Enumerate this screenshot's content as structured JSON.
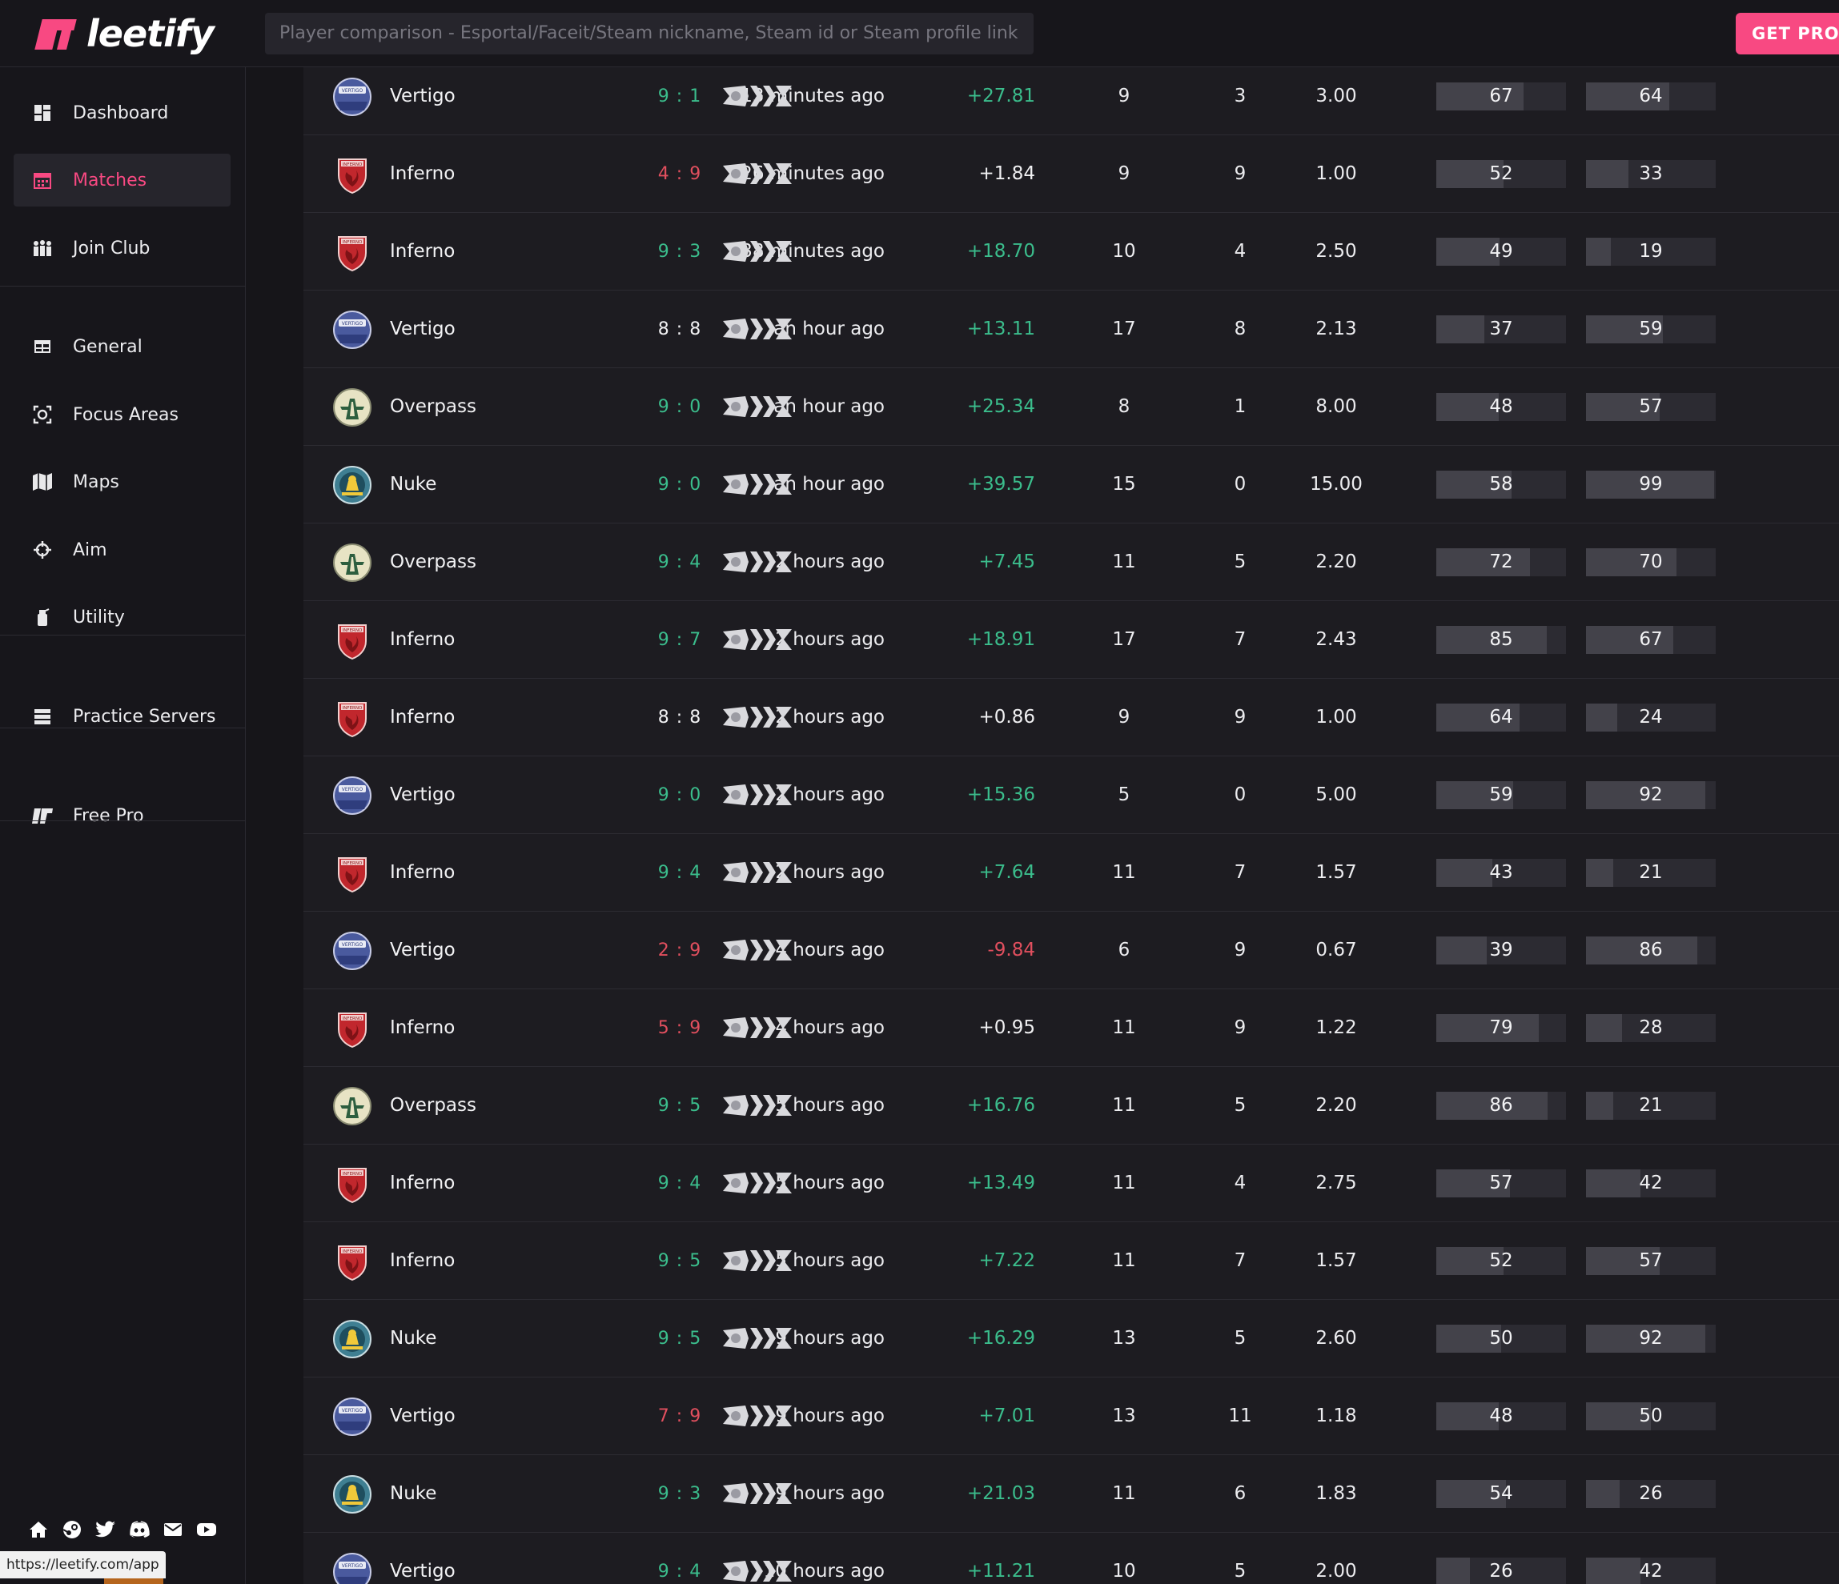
{
  "app": {
    "logo_text": "leetify",
    "get_pro_label": "GET PRO"
  },
  "search": {
    "placeholder": "Player comparison - Esportal/Faceit/Steam nickname, Steam id or Steam profile link"
  },
  "sidebar": {
    "items": [
      {
        "label": "Dashboard",
        "icon": "dashboard-icon",
        "active": false
      },
      {
        "label": "Matches",
        "icon": "calendar-icon",
        "active": true
      },
      {
        "label": "Join Club",
        "icon": "club-icon",
        "active": false
      },
      {
        "label": "General",
        "icon": "table-icon",
        "active": false
      },
      {
        "label": "Focus Areas",
        "icon": "focus-icon",
        "active": false
      },
      {
        "label": "Maps",
        "icon": "map-icon",
        "active": false
      },
      {
        "label": "Aim",
        "icon": "crosshair-icon",
        "active": false
      },
      {
        "label": "Utility",
        "icon": "grenade-icon",
        "active": false
      },
      {
        "label": "Practice Servers",
        "icon": "server-icon",
        "active": false
      },
      {
        "label": "Free Pro",
        "icon": "leetify-logo-icon",
        "active": false
      }
    ],
    "social_icons": [
      "home-icon",
      "steam-icon",
      "twitter-icon",
      "discord-icon",
      "mail-icon",
      "youtube-icon"
    ]
  },
  "status_url": "https://leetify.com/app",
  "colors": {
    "accent": "#f84982",
    "win": "#3bbd8c",
    "loss": "#e14f5e"
  },
  "matches": [
    {
      "map": "Vertigo",
      "time": "13 minutes ago",
      "score": "9 : 1",
      "result": "win",
      "rating": "+27.81",
      "kills": "9",
      "deaths": "3",
      "kd": "3.00",
      "stat1": 67,
      "stat2": 64
    },
    {
      "map": "Inferno",
      "time": "26 minutes ago",
      "score": "4 : 9",
      "result": "loss",
      "rating": "+1.84",
      "kills": "9",
      "deaths": "9",
      "kd": "1.00",
      "stat1": 52,
      "stat2": 33
    },
    {
      "map": "Inferno",
      "time": "38 minutes ago",
      "score": "9 : 3",
      "result": "win",
      "rating": "+18.70",
      "kills": "10",
      "deaths": "4",
      "kd": "2.50",
      "stat1": 49,
      "stat2": 19
    },
    {
      "map": "Vertigo",
      "time": "an hour ago",
      "score": "8 : 8",
      "result": "tie",
      "rating": "+13.11",
      "kills": "17",
      "deaths": "8",
      "kd": "2.13",
      "stat1": 37,
      "stat2": 59
    },
    {
      "map": "Overpass",
      "time": "an hour ago",
      "score": "9 : 0",
      "result": "win",
      "rating": "+25.34",
      "kills": "8",
      "deaths": "1",
      "kd": "8.00",
      "stat1": 48,
      "stat2": 57
    },
    {
      "map": "Nuke",
      "time": "an hour ago",
      "score": "9 : 0",
      "result": "win",
      "rating": "+39.57",
      "kills": "15",
      "deaths": "0",
      "kd": "15.00",
      "stat1": 58,
      "stat2": 99
    },
    {
      "map": "Overpass",
      "time": "2 hours ago",
      "score": "9 : 4",
      "result": "win",
      "rating": "+7.45",
      "kills": "11",
      "deaths": "5",
      "kd": "2.20",
      "stat1": 72,
      "stat2": 70
    },
    {
      "map": "Inferno",
      "time": "2 hours ago",
      "score": "9 : 7",
      "result": "win",
      "rating": "+18.91",
      "kills": "17",
      "deaths": "7",
      "kd": "2.43",
      "stat1": 85,
      "stat2": 67
    },
    {
      "map": "Inferno",
      "time": "2 hours ago",
      "score": "8 : 8",
      "result": "tie",
      "rating": "+0.86",
      "kills": "9",
      "deaths": "9",
      "kd": "1.00",
      "stat1": 64,
      "stat2": 24
    },
    {
      "map": "Vertigo",
      "time": "2 hours ago",
      "score": "9 : 0",
      "result": "win",
      "rating": "+15.36",
      "kills": "5",
      "deaths": "0",
      "kd": "5.00",
      "stat1": 59,
      "stat2": 92
    },
    {
      "map": "Inferno",
      "time": "2 hours ago",
      "score": "9 : 4",
      "result": "win",
      "rating": "+7.64",
      "kills": "11",
      "deaths": "7",
      "kd": "1.57",
      "stat1": 43,
      "stat2": 21
    },
    {
      "map": "Vertigo",
      "time": "4 hours ago",
      "score": "2 : 9",
      "result": "loss",
      "rating": "-9.84",
      "kills": "6",
      "deaths": "9",
      "kd": "0.67",
      "stat1": 39,
      "stat2": 86
    },
    {
      "map": "Inferno",
      "time": "4 hours ago",
      "score": "5 : 9",
      "result": "loss",
      "rating": "+0.95",
      "kills": "11",
      "deaths": "9",
      "kd": "1.22",
      "stat1": 79,
      "stat2": 28
    },
    {
      "map": "Overpass",
      "time": "5 hours ago",
      "score": "9 : 5",
      "result": "win",
      "rating": "+16.76",
      "kills": "11",
      "deaths": "5",
      "kd": "2.20",
      "stat1": 86,
      "stat2": 21
    },
    {
      "map": "Inferno",
      "time": "5 hours ago",
      "score": "9 : 4",
      "result": "win",
      "rating": "+13.49",
      "kills": "11",
      "deaths": "4",
      "kd": "2.75",
      "stat1": 57,
      "stat2": 42
    },
    {
      "map": "Inferno",
      "time": "5 hours ago",
      "score": "9 : 5",
      "result": "win",
      "rating": "+7.22",
      "kills": "11",
      "deaths": "7",
      "kd": "1.57",
      "stat1": 52,
      "stat2": 57
    },
    {
      "map": "Nuke",
      "time": "9 hours ago",
      "score": "9 : 5",
      "result": "win",
      "rating": "+16.29",
      "kills": "13",
      "deaths": "5",
      "kd": "2.60",
      "stat1": 50,
      "stat2": 92
    },
    {
      "map": "Vertigo",
      "time": "9 hours ago",
      "score": "7 : 9",
      "result": "loss",
      "rating": "+7.01",
      "kills": "13",
      "deaths": "11",
      "kd": "1.18",
      "stat1": 48,
      "stat2": 50
    },
    {
      "map": "Nuke",
      "time": "9 hours ago",
      "score": "9 : 3",
      "result": "win",
      "rating": "+21.03",
      "kills": "11",
      "deaths": "6",
      "kd": "1.83",
      "stat1": 54,
      "stat2": 26
    },
    {
      "map": "Vertigo",
      "time": "10 hours ago",
      "score": "9 : 4",
      "result": "win",
      "rating": "+11.21",
      "kills": "10",
      "deaths": "5",
      "kd": "2.00",
      "stat1": 26,
      "stat2": 42
    }
  ]
}
